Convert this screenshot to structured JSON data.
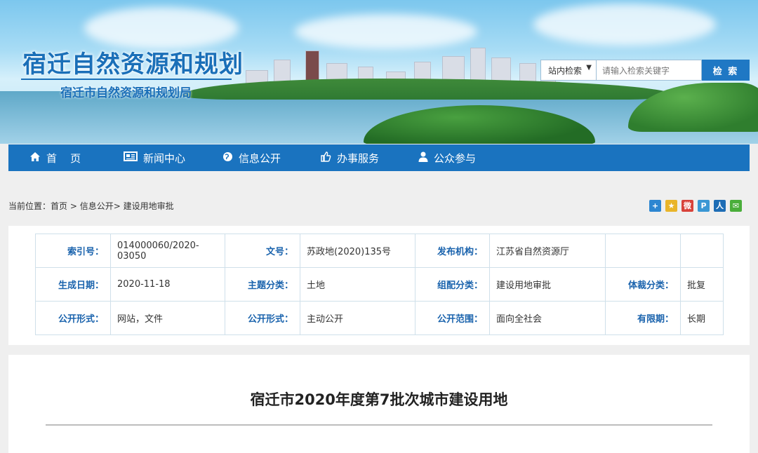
{
  "site": {
    "title": "宿迁自然资源和规划",
    "subtitle": "宿迁市自然资源和规划局"
  },
  "search": {
    "scope_label": "站内检索",
    "placeholder": "请输入检索关键字",
    "button_label": "检 索"
  },
  "nav": {
    "items": [
      {
        "label": "首    页",
        "icon": "home-icon"
      },
      {
        "label": "新闻中心",
        "icon": "newspaper-icon"
      },
      {
        "label": "信息公开",
        "icon": "globe-icon"
      },
      {
        "label": "办事服务",
        "icon": "thumbs-up-icon"
      },
      {
        "label": "公众参与",
        "icon": "user-icon"
      }
    ]
  },
  "breadcrumb": {
    "prefix": "当前位置：",
    "items": [
      "首页",
      "信息公开",
      "建设用地审批"
    ],
    "separator": " > "
  },
  "share_icons": [
    "share-plus-icon",
    "qzone-icon",
    "weibo-icon",
    "tencent-weibo-icon",
    "renren-icon",
    "wechat-icon"
  ],
  "info": {
    "rows": [
      [
        {
          "label": "索引号：",
          "value": "014000060/2020-03050"
        },
        {
          "label": "文号：",
          "value": "苏政地(2020)135号"
        },
        {
          "label": "发布机构：",
          "value": "江苏省自然资源厅"
        },
        {
          "label": "",
          "value": ""
        }
      ],
      [
        {
          "label": "生成日期：",
          "value": "2020-11-18"
        },
        {
          "label": "主题分类：",
          "value": "土地"
        },
        {
          "label": "组配分类：",
          "value": "建设用地审批"
        },
        {
          "label": "体裁分类：",
          "value": "批复"
        }
      ],
      [
        {
          "label": "公开形式：",
          "value": "网站，文件"
        },
        {
          "label": "公开形式：",
          "value": "主动公开"
        },
        {
          "label": "公开范围：",
          "value": "面向全社会"
        },
        {
          "label": "有限期：",
          "value": "长期"
        }
      ]
    ]
  },
  "article": {
    "title": "宿迁市2020年度第7批次城市建设用地"
  },
  "colors": {
    "brand_blue": "#1a73bf",
    "label_blue": "#1a63ad"
  }
}
